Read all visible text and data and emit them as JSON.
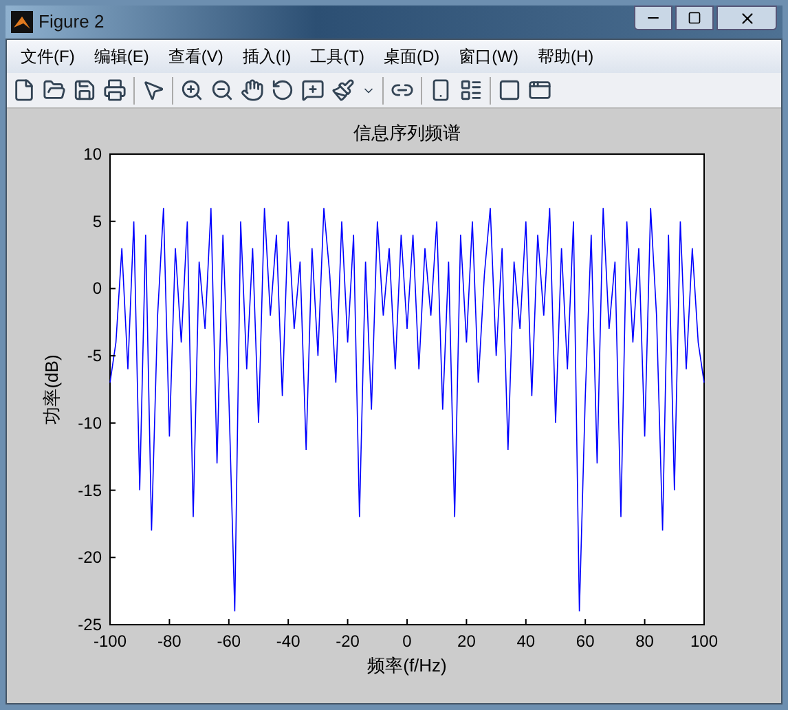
{
  "window": {
    "title": "Figure 2"
  },
  "menu": [
    {
      "label": "文件(F)"
    },
    {
      "label": "编辑(E)"
    },
    {
      "label": "查看(V)"
    },
    {
      "label": "插入(I)"
    },
    {
      "label": "工具(T)"
    },
    {
      "label": "桌面(D)"
    },
    {
      "label": "窗口(W)"
    },
    {
      "label": "帮助(H)"
    }
  ],
  "axes": {
    "chart_data": {
      "type": "line",
      "title": "信息序列频谱",
      "xlabel": "频率(f/Hz)",
      "ylabel": "功率(dB)",
      "xlim": [
        -100,
        100
      ],
      "x": [
        -100,
        -98,
        -96,
        -94,
        -92,
        -90,
        -88,
        -86,
        -84,
        -82,
        -80,
        -78,
        -76,
        -74,
        -72,
        -70,
        -68,
        -66,
        -64,
        -62,
        -60,
        -58,
        -56,
        -54,
        -52,
        -50,
        -48,
        -46,
        -44,
        -42,
        -40,
        -38,
        -36,
        -34,
        -32,
        -30,
        -28,
        -26,
        -24,
        -22,
        -20,
        -18,
        -16,
        -14,
        -12,
        -10,
        -8,
        -6,
        -4,
        -2,
        0,
        2,
        4,
        6,
        8,
        10,
        12,
        14,
        16,
        18,
        20,
        22,
        24,
        26,
        28,
        30,
        32,
        34,
        36,
        38,
        40,
        42,
        44,
        46,
        48,
        50,
        52,
        54,
        56,
        58,
        60,
        62,
        64,
        66,
        68,
        70,
        72,
        74,
        76,
        78,
        80,
        82,
        84,
        86,
        88,
        90,
        92,
        94,
        96,
        98,
        100
      ],
      "ylim": [
        -25,
        10
      ],
      "xticks": [
        -100,
        -80,
        -60,
        -40,
        -20,
        0,
        20,
        40,
        60,
        80,
        100
      ],
      "yticks": [
        10,
        5,
        0,
        -5,
        -10,
        -15,
        -20,
        -25
      ],
      "series": [
        {
          "color": "#0000ff",
          "values": [
            -7,
            -4,
            3,
            -6,
            5,
            -15,
            4,
            -18,
            -2,
            6,
            -11,
            3,
            -4,
            5,
            -17,
            2,
            -3,
            6,
            -13,
            4,
            -8,
            -24,
            5,
            -6,
            3,
            -10,
            6,
            -2,
            4,
            -8,
            5,
            -3,
            2,
            -12,
            3,
            -5,
            6,
            1,
            -7,
            5,
            -4,
            4,
            -17,
            2,
            -9,
            5,
            -2,
            3,
            -6,
            4,
            -3,
            4,
            -6,
            3,
            -2,
            5,
            -9,
            2,
            -17,
            4,
            -4,
            5,
            -7,
            1,
            6,
            -5,
            3,
            -12,
            2,
            -3,
            5,
            -8,
            4,
            -2,
            6,
            -10,
            3,
            -6,
            5,
            -24,
            -8,
            4,
            -13,
            6,
            -3,
            2,
            -17,
            5,
            -4,
            3,
            -11,
            6,
            -2,
            -18,
            4,
            -15,
            5,
            -6,
            3,
            -4,
            -7
          ]
        }
      ]
    }
  }
}
